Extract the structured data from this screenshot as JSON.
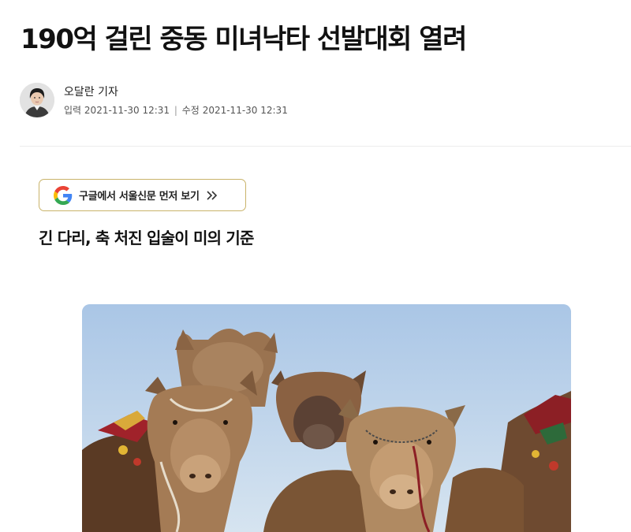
{
  "article": {
    "headline": "190억 걸린 중동 미녀낙타 선발대회 열려",
    "author": "오달란 기자",
    "published_label": "입력",
    "published_at": "2021-11-30 12:31",
    "separator": "|",
    "modified_label": "수정",
    "modified_at": "2021-11-30 12:31",
    "subtitle": "긴 다리, 축 처진 입술이 미의 기준"
  },
  "google_follow": {
    "label": "구글에서 서울신문 먼저 보기",
    "icon": "google-g-icon",
    "arrow_icon": "double-chevron-right-icon"
  },
  "photo": {
    "subject": "camels-photo"
  },
  "colors": {
    "button_border": "#c9b36a",
    "google_blue": "#4285F4",
    "google_red": "#EA4335",
    "google_yellow": "#FBBC05",
    "google_green": "#34A853",
    "sky": "#b9d1e8"
  }
}
